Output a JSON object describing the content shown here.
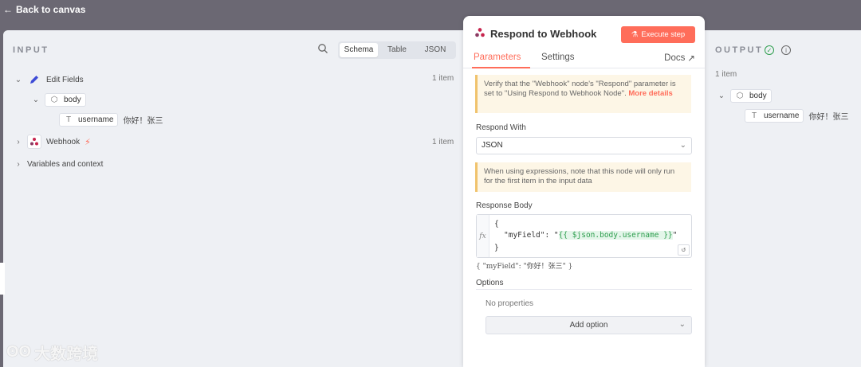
{
  "topbar": {
    "back_label": "Back to canvas"
  },
  "input": {
    "title": "INPUT",
    "view_tabs": [
      "Schema",
      "Table",
      "JSON"
    ],
    "tree": {
      "edit_fields": {
        "label": "Edit Fields",
        "count": "1 item"
      },
      "body": "body",
      "username_key": "username",
      "username_value": "你好！张三",
      "webhook": {
        "label": "Webhook",
        "count": "1 item"
      },
      "variables": "Variables and context"
    }
  },
  "node": {
    "title": "Respond to Webhook",
    "execute_label": "Execute step",
    "tabs": [
      "Parameters",
      "Settings"
    ],
    "docs_label": "Docs",
    "notice1_text": "Verify that the \"Webhook\" node's \"Respond\" parameter is set to \"Using Respond to Webhook Node\".",
    "notice1_link": "More details",
    "respond_with_label": "Respond With",
    "respond_with_value": "JSON",
    "notice2_text": "When using expressions, note that this node will only run for the first item in the input data",
    "response_body_label": "Response Body",
    "code": {
      "line1": "{",
      "line2_key": "\"myField\": \"",
      "line2_expr": "{{ $json.body.username }}",
      "line2_end": "\"",
      "line3": "}"
    },
    "preview": "{   \"myField\": \"你好！张三\" }",
    "options_label": "Options",
    "no_properties": "No properties",
    "add_option": "Add option"
  },
  "output": {
    "title": "OUTPUT",
    "count": "1 item",
    "body": "body",
    "username_key": "username",
    "username_value": "你好！张三"
  },
  "watermark": "大数跨境",
  "colors": {
    "accent": "#ff6d5a",
    "success": "#2e9e4e",
    "panel_bg": "#eef0f4",
    "topbar": "#6b6873"
  }
}
